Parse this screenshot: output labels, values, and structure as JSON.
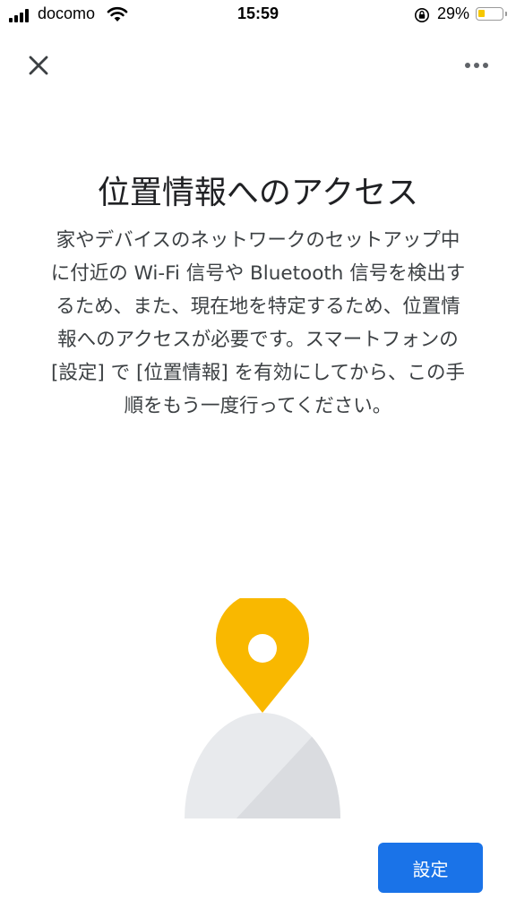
{
  "status_bar": {
    "carrier": "docomo",
    "time": "15:59",
    "battery_percent": "29%",
    "battery_level": 0.29,
    "icons": [
      "signal-icon",
      "wifi-icon",
      "orientation-lock-icon",
      "battery-icon"
    ]
  },
  "top_bar": {
    "close_icon": "close-icon",
    "more_icon": "more-horizontal-icon"
  },
  "content": {
    "title": "位置情報へのアクセス",
    "body_lines": [
      "家やデバイスのネットワークのセットアップ中",
      "に付近の Wi-Fi 信号や Bluetooth 信号を検出す",
      "るため、また、現在地を特定するため、位置情",
      "報へのアクセスが必要です。スマートフォンの",
      "[設定] で [位置情報] を有効にしてから、この手",
      "順をもう一度行ってください。"
    ]
  },
  "illustration": {
    "icon": "location-pin-person-illustration",
    "colors": {
      "pin": "#f9b800",
      "body_light": "#e8eaed",
      "body_shade": "#dadce0"
    }
  },
  "footer": {
    "settings_button_label": "設定"
  },
  "colors": {
    "accent": "#1a73e8",
    "text": "#202124",
    "battery": "#f6c700"
  }
}
